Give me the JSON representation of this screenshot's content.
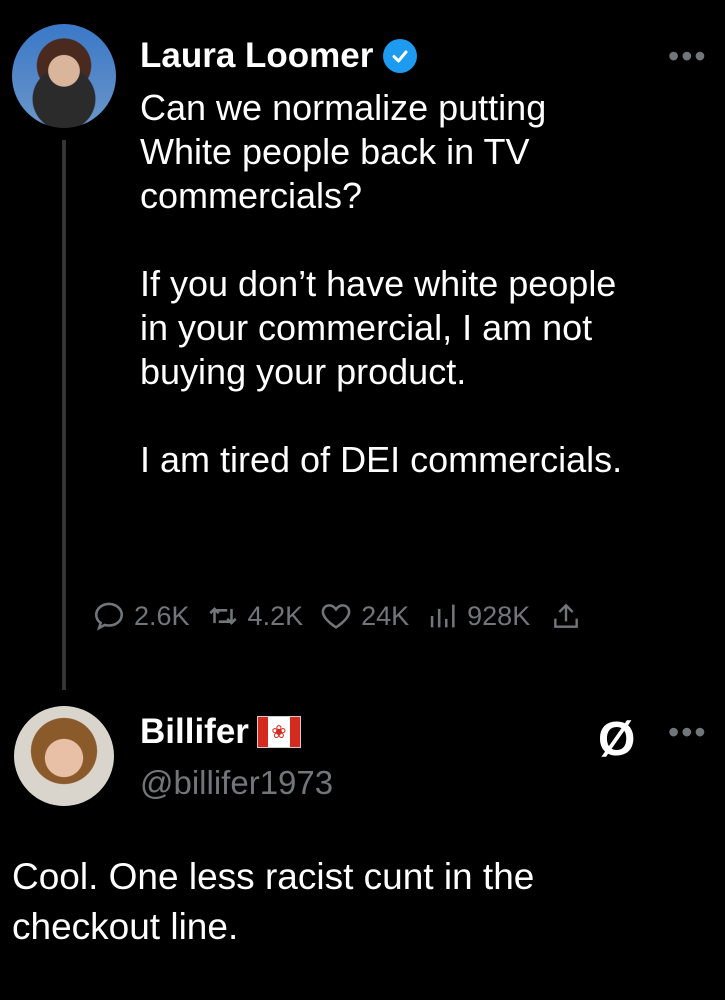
{
  "post1": {
    "author_name": "Laura Loomer",
    "verified_icon": "verified-badge-icon",
    "more_label": "•••",
    "lines": [
      "Can we normalize putting",
      "White people back in TV",
      "commercials?",
      "",
      "If you don’t have white people",
      "in your commercial, I am not",
      "buying your product.",
      "",
      "I am tired of DEI commercials."
    ],
    "metrics": {
      "replies": "2.6K",
      "reposts": "4.2K",
      "likes": "24K",
      "views": "928K"
    }
  },
  "post2": {
    "author_name": "Billifer",
    "flag_icon": "canada-flag-icon",
    "handle": "@billifer1973",
    "grok_icon_glyph": "Ø",
    "more_label": "•••",
    "lines": [
      "Cool. One less racist cunt in the",
      "checkout line."
    ]
  },
  "colors": {
    "background": "#000000",
    "text": "#ffffff",
    "secondary": "#71767b",
    "verified": "#1d9bf0"
  }
}
